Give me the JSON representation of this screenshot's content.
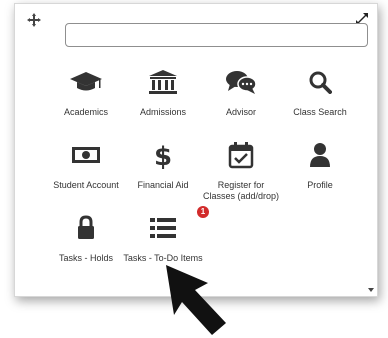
{
  "search": {
    "placeholder": "",
    "value": ""
  },
  "tiles": [
    {
      "label": "Academics",
      "icon": "graduation-cap-icon"
    },
    {
      "label": "Admissions",
      "icon": "institution-icon"
    },
    {
      "label": "Advisor",
      "icon": "chat-bubbles-icon"
    },
    {
      "label": "Class Search",
      "icon": "search-icon"
    },
    {
      "label": "Student Account",
      "icon": "money-bill-icon"
    },
    {
      "label": "Financial Aid",
      "icon": "dollar-sign-icon"
    },
    {
      "label": "Register for Classes (add/drop)",
      "icon": "calendar-check-icon"
    },
    {
      "label": "Profile",
      "icon": "user-icon"
    },
    {
      "label": "Tasks - Holds",
      "icon": "lock-icon"
    },
    {
      "label": "Tasks - To-Do Items",
      "icon": "list-icon"
    }
  ],
  "badge": {
    "count": "1",
    "color": "#d22b2b"
  },
  "colors": {
    "icon": "#333333",
    "panel_border": "#d7d7d7"
  }
}
